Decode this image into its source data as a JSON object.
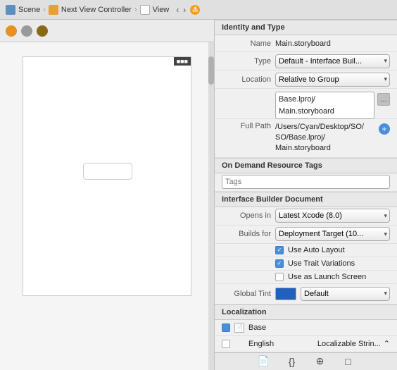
{
  "topbar": {
    "scene_label": "Scene",
    "vc_label": "Next View Controller",
    "view_label": "View",
    "warn_symbol": "⚠"
  },
  "rightpanel": {
    "identity_section": "Identity and Type",
    "name_label": "Name",
    "name_value": "Main.storyboard",
    "type_label": "Type",
    "type_value": "Default - Interface Buil...",
    "location_label": "Location",
    "location_value": "Relative to Group",
    "location_path1": "Base.lproj/",
    "location_path2": "Main.storyboard",
    "fullpath_label": "Full Path",
    "fullpath_line1": "/Users/Cyan/Desktop/SO/",
    "fullpath_line2": "SO/Base.lproj/",
    "fullpath_line3": "Main.storyboard",
    "ondemand_section": "On Demand Resource Tags",
    "tags_placeholder": "Tags",
    "ib_section": "Interface Builder Document",
    "opens_in_label": "Opens in",
    "opens_in_value": "Latest Xcode (8.0)",
    "builds_for_label": "Builds for",
    "builds_for_value": "Deployment Target (10...",
    "cb_auto_layout": "Use Auto Layout",
    "cb_trait_variations": "Use Trait Variations",
    "cb_launch_screen": "Use as Launch Screen",
    "global_tint_label": "Global Tint",
    "global_tint_name": "Default",
    "localization_section": "Localization",
    "base_label": "Base",
    "english_label": "English",
    "english_right": "Localizable Strin...",
    "chevron_symbol": "⌃"
  },
  "bottom_toolbar": {
    "icon1": "📄",
    "icon2": "{}",
    "icon3": "⊕",
    "icon4": "□"
  }
}
